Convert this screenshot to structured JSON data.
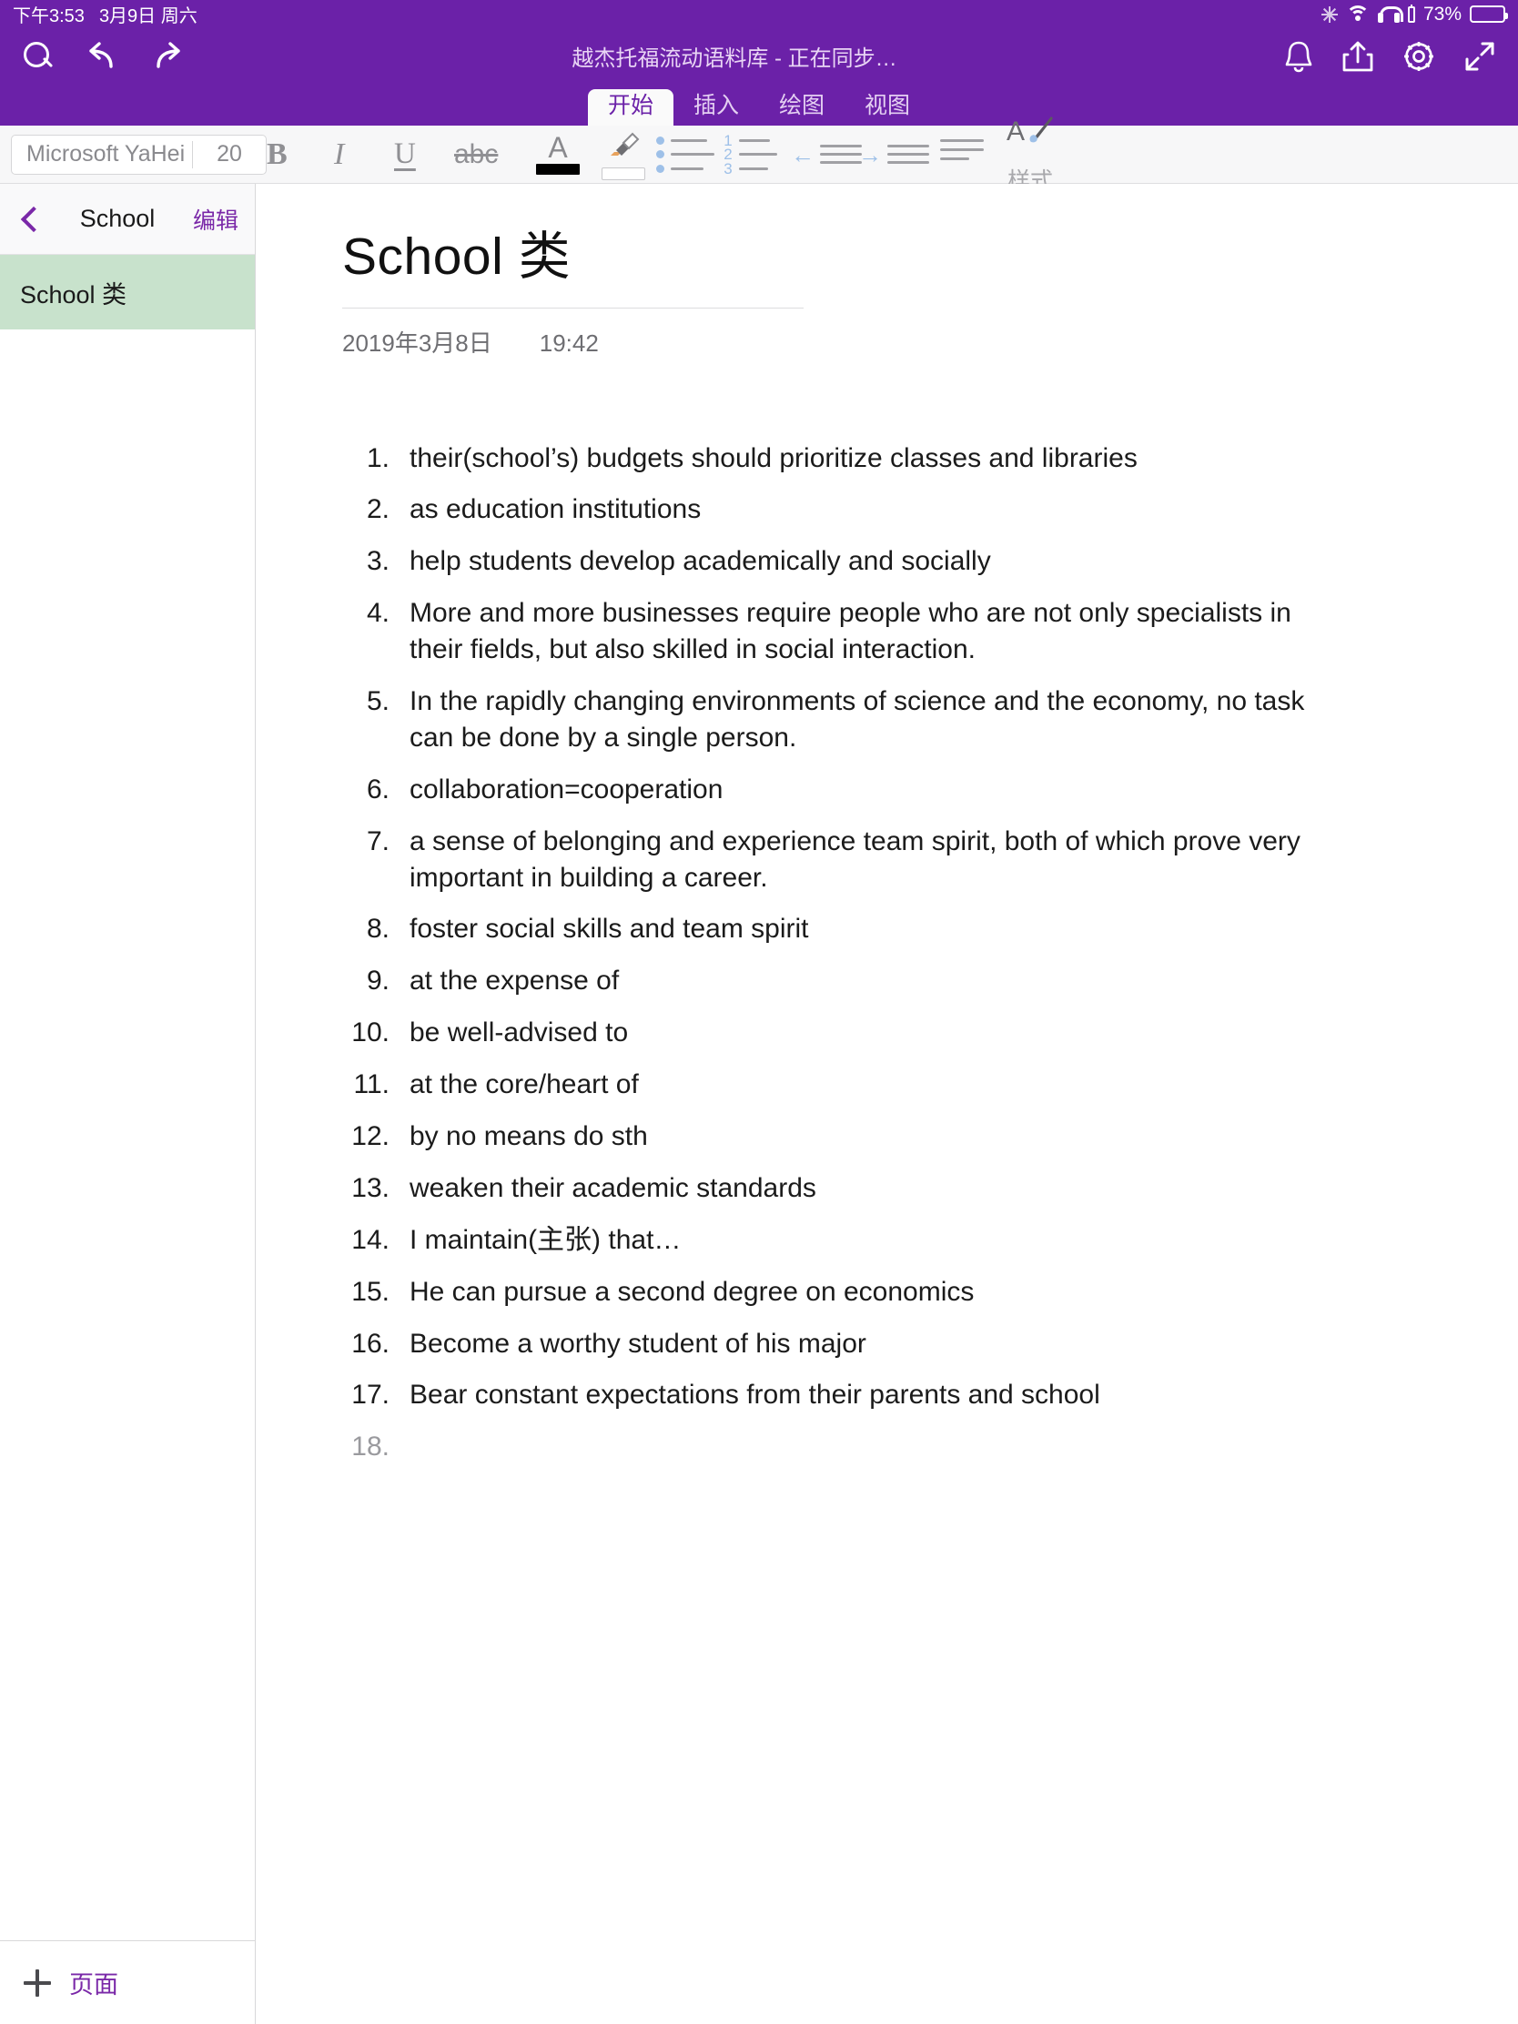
{
  "statusbar": {
    "time": "下午3:53",
    "date": "3月9日 周六",
    "battery_percent": "73%",
    "icons": [
      "sync-icon",
      "wifi-icon",
      "headphones-icon",
      "battery-small-icon",
      "battery-icon"
    ]
  },
  "appbar": {
    "title": "越杰托福流动语料库 - 正在同步…",
    "left_icons": [
      "search-icon",
      "undo-icon",
      "redo-icon"
    ],
    "right_icons": [
      "bell-icon",
      "share-icon",
      "gear-icon",
      "expand-icon"
    ]
  },
  "ribbon": {
    "tabs": [
      {
        "label": "开始",
        "active": true
      },
      {
        "label": "插入",
        "active": false
      },
      {
        "label": "绘图",
        "active": false
      },
      {
        "label": "视图",
        "active": false
      }
    ]
  },
  "toolbar": {
    "font_name": "Microsoft YaHei",
    "font_size": "20",
    "bold_label": "B",
    "italic_label": "I",
    "underline_label": "U",
    "strike_label": "abc",
    "font_color_label": "A",
    "font_color_swatch": "#000000",
    "highlight_swatch": "#FFFFFF",
    "numbered_list_digits": [
      "1",
      "2",
      "3"
    ],
    "styles_label": "样式",
    "styles_icon_label": "A"
  },
  "sidebar": {
    "back_icon": "chevron-left-icon",
    "section_title": "School",
    "edit_label": "编辑",
    "pages": [
      {
        "label": "School 类",
        "selected": true
      }
    ],
    "add_page_label": "页面"
  },
  "note": {
    "title": "School 类",
    "date": "2019年3月8日",
    "time": "19:42",
    "items": [
      {
        "num": "1.",
        "text": "their(school’s) budgets should prioritize classes and libraries"
      },
      {
        "num": "2.",
        "text": "as education institutions"
      },
      {
        "num": "3.",
        "text": "help students develop academically and socially"
      },
      {
        "num": "4.",
        "text": "More and more businesses require people who are not only specialists in their fields, but also skilled in social interaction."
      },
      {
        "num": "5.",
        "text": "In the rapidly changing environments of science and the economy, no task can be done by a single person."
      },
      {
        "num": "6.",
        "text": "collaboration=cooperation"
      },
      {
        "num": "7.",
        "text": "a sense of belonging and experience team spirit, both of which prove very important in building a career."
      },
      {
        "num": "8.",
        "text": "foster social skills and team spirit"
      },
      {
        "num": "9.",
        "text": "at the expense of"
      },
      {
        "num": "10.",
        "text": "be well-advised to"
      },
      {
        "num": "11.",
        "text": "at the core/heart of"
      },
      {
        "num": "12.",
        "text": "by no means do sth"
      },
      {
        "num": "13.",
        "text": "weaken their academic standards"
      },
      {
        "num": "14.",
        "text": "I maintain(主张) that…"
      },
      {
        "num": "15.",
        "text": "He can pursue a second degree on economics"
      },
      {
        "num": "16.",
        "text": "Become a worthy student of his major"
      },
      {
        "num": "17.",
        "text": "Bear constant expectations from their parents and school"
      },
      {
        "num": "18.",
        "text": ""
      }
    ]
  },
  "colors": {
    "brand_purple": "#6B21A8",
    "accent_purple": "#7A28A8",
    "selected_page_green": "#C8E2CC",
    "list_blue": "#9EC0E8"
  }
}
